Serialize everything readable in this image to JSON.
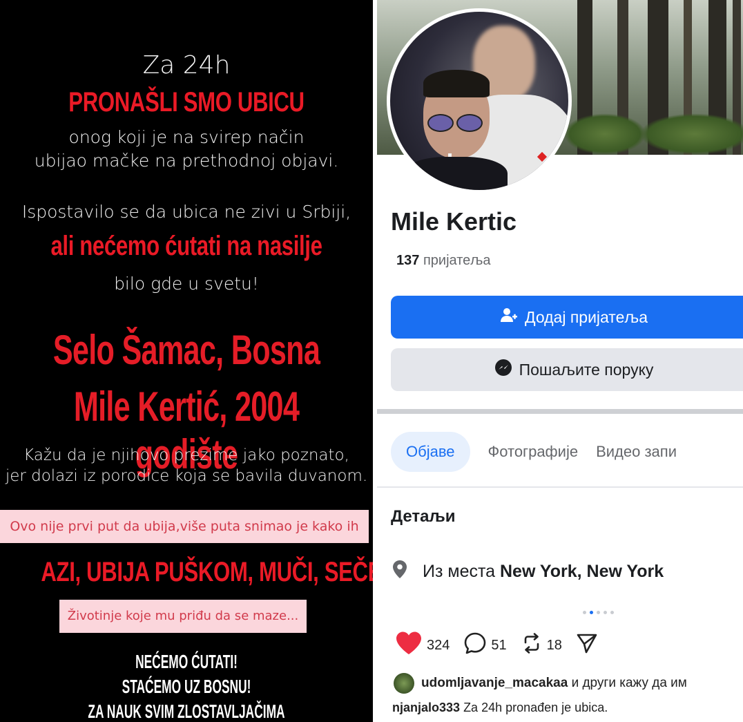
{
  "story": {
    "line_za24h": "Za 24h",
    "line_pronasli": "PRONAŠLI SMO UBICU",
    "line_onog1": "onog koji je na svirep način",
    "line_onog2": "ubijao mačke na prethodnoj objavi.",
    "line_ispost": "Ispostavilo se da ubica ne zivi u Srbiji,",
    "line_ali": "ali nećemo ćutati na nasilje",
    "line_bilo": "bilo gde u svetu!",
    "line_selo": "Selo Šamac, Bosna",
    "line_mile": "Mile Kertić, 2004 godište",
    "line_kazu1": "Kažu da je njihovo prezime jako poznato,",
    "line_kazu2": "jer dolazi iz porodice koja se bavila duvanom.",
    "pink1": "Ovo nije prvi put da ubija,više puta snimao je kako ih",
    "line_azi": "AZI, UBIJA PUŠKOM, MUČI, SEČE REPOVE NA ŽIV",
    "pink2": "Životinje koje mu priđu da se maze...",
    "line_necemo": "NEĆEMO ĆUTATI!",
    "line_stacemo": "STAĆEMO UZ BOSNU!",
    "line_zanauk": "ZA NAUK SVIM ZLOSTAVLJAČIMA ŠIROM SVETA!"
  },
  "profile": {
    "name": "Mile Kertic",
    "friends_count": "137",
    "friends_label": "пријатеља",
    "add_friend": "Додај пријатеља",
    "send_message": "Пошаљите поруку",
    "tabs": [
      "Објаве",
      "Фотографије",
      "Видео запи"
    ],
    "details_title": "Детаљи",
    "location_prefix": "Из места",
    "location_value": "New York, New York"
  },
  "post": {
    "likes": "324",
    "comments": "51",
    "reposts": "18",
    "liked_by_user": "udomljavanje_macakaa",
    "liked_by_suffix": "и други кажу да им",
    "caption_user": "njanjalo333",
    "caption_text": "Za 24h pronađen je ubica."
  },
  "colors": {
    "accent_blue": "#1a6ff2",
    "story_red": "#ea1a26",
    "like_red": "#ed2d42"
  },
  "icons": [
    "person-add-icon",
    "messenger-icon",
    "location-pin-icon",
    "heart-icon",
    "comment-icon",
    "repost-icon",
    "share-send-icon"
  ]
}
